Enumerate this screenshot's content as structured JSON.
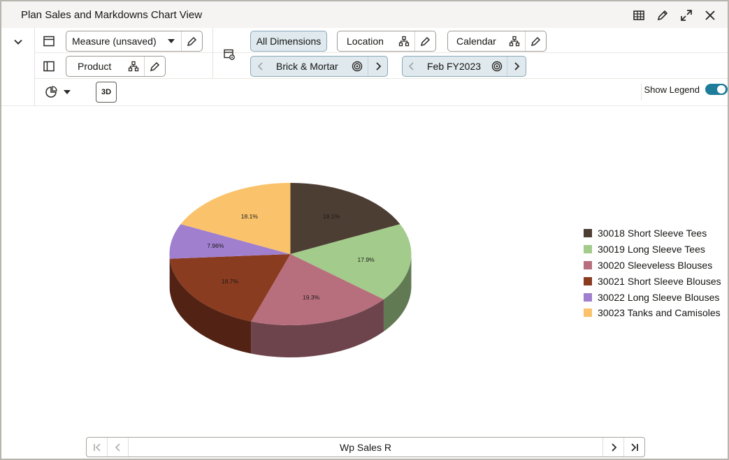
{
  "window": {
    "title": "Plan Sales and Markdowns Chart View"
  },
  "toolbar": {
    "measure_label": "Measure (unsaved)",
    "product_label": "Product",
    "all_dimensions_label": "All Dimensions",
    "location_label": "Location",
    "calendar_label": "Calendar",
    "location_value": "Brick & Mortar",
    "calendar_value": "Feb FY2023",
    "btn_3d": "3D",
    "show_legend_label": "Show Legend",
    "show_legend_on": true
  },
  "colors": {
    "accent": "#1d7c9a"
  },
  "chart_data": {
    "type": "pie",
    "three_d": true,
    "slices": [
      {
        "label": "30018 Short Sleeve Tees",
        "value": 18.1,
        "value_label": "18.1%",
        "color": "#4d3e33",
        "side": "#3a2e26"
      },
      {
        "label": "30019 Long Sleeve Tees",
        "value": 17.9,
        "value_label": "17.9%",
        "color": "#a3cb8b",
        "side": "#617a53"
      },
      {
        "label": "30020 Sleeveless Blouses",
        "value": 19.3,
        "value_label": "19.3%",
        "color": "#b86f7d",
        "side": "#6d434c"
      },
      {
        "label": "30021 Short Sleeve Blouses",
        "value": 18.7,
        "value_label": "18.7%",
        "color": "#8a3c20",
        "side": "#522314"
      },
      {
        "label": "30022 Long Sleeve Blouses",
        "value": 7.96,
        "value_label": "7.96%",
        "color": "#a07fcf",
        "side": "#5f4d7c"
      },
      {
        "label": "30023 Tanks and Camisoles",
        "value": 18.1,
        "value_label": "18.1%",
        "color": "#fac36b",
        "side": "#967540"
      }
    ],
    "legend_position": "right"
  },
  "pager": {
    "label": "Wp Sales R"
  }
}
